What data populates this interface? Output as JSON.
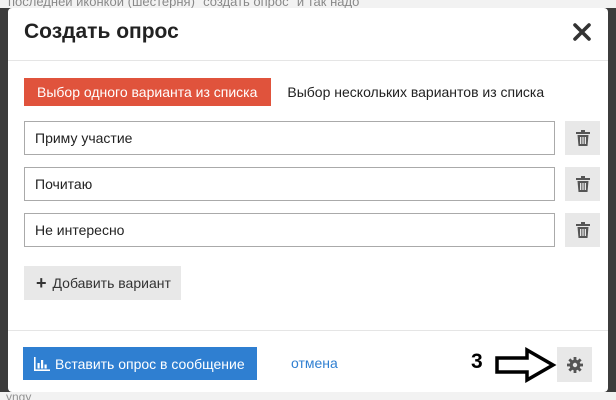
{
  "background": {
    "top_text": "последней иконкой (шестерня) \"создать опрос\" и так надо",
    "bottom_text": "yngy"
  },
  "dialog": {
    "title": "Создать опрос",
    "close_icon": "close-icon"
  },
  "tabs": [
    {
      "label": "Выбор одного варианта из списка",
      "active": true
    },
    {
      "label": "Выбор нескольких вариантов из списка",
      "active": false
    }
  ],
  "options": [
    {
      "value": "Приму участие",
      "delete_icon": "trash-icon"
    },
    {
      "value": "Почитаю",
      "delete_icon": "trash-icon"
    },
    {
      "value": "Не интересно",
      "delete_icon": "trash-icon"
    }
  ],
  "add_option": {
    "label": "Добавить вариант",
    "icon": "plus-icon"
  },
  "footer": {
    "insert_label": "Вставить опрос в сообщение",
    "insert_icon": "bar-chart-icon",
    "cancel_label": "отмена",
    "annotation_number": "3",
    "annotation_icon": "right-arrow-outline",
    "settings_icon": "gear-icon"
  },
  "colors": {
    "active_tab": "#e0533c",
    "primary_button": "#2f7fd1",
    "link": "#2f7fd1",
    "secondary_button": "#e8e8e8"
  }
}
